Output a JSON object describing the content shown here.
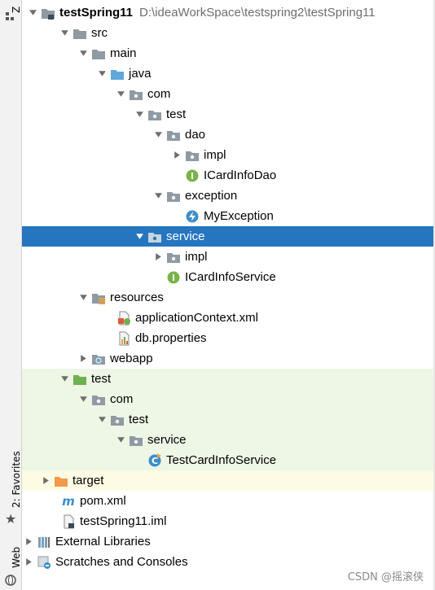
{
  "side_strip": {
    "structure_tab": "Z",
    "favorites_tab": "2: Favorites",
    "web_tab": "Web",
    "icons": [
      "structure-icon",
      "star-icon",
      "web-icon"
    ]
  },
  "colors": {
    "selection": "#2675bf",
    "test_root_bg": "#eef6e6",
    "excluded_bg": "#fdfbe3",
    "folder_grey": "#8f9aa3",
    "folder_blue": "#5fa8d9",
    "folder_green": "#6fb04f",
    "folder_orange": "#f29a4a",
    "interface_green": "#79b44a",
    "class_blue": "#3c8dc9"
  },
  "tree": {
    "project": {
      "name": "testSpring11",
      "path": "D:\\ideaWorkSpace\\testspring2\\testSpring11"
    },
    "src": "src",
    "main": "main",
    "java": "java",
    "com": "com",
    "test": "test",
    "dao": "dao",
    "dao_impl": "impl",
    "icardinfodao": "ICardInfoDao",
    "exception": "exception",
    "myexception": "MyException",
    "service": "service",
    "service_impl": "impl",
    "icardinfoservice": "ICardInfoService",
    "resources": "resources",
    "applicationcontext": "applicationContext.xml",
    "dbproperties": "db.properties",
    "webapp": "webapp",
    "test_root": "test",
    "test_com": "com",
    "test_test": "test",
    "test_service": "service",
    "testcardinfoservice": "TestCardInfoService",
    "target": "target",
    "pom": "pom.xml",
    "iml": "testSpring11.iml",
    "external_libraries": "External Libraries",
    "scratches": "Scratches and Consoles"
  },
  "watermark": "CSDN @摇滚侠"
}
